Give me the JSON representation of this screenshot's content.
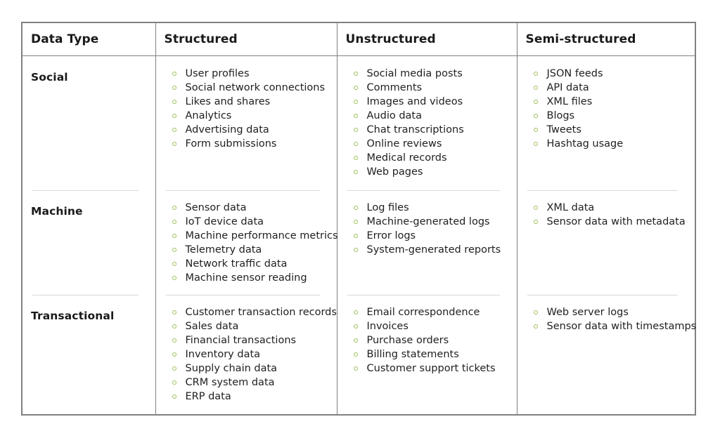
{
  "table": {
    "columns": [
      {
        "key": "data_type",
        "label": "Data Type"
      },
      {
        "key": "structured",
        "label": "Structured"
      },
      {
        "key": "unstructured",
        "label": "Unstructured"
      },
      {
        "key": "semi_structured",
        "label": "Semi-structured"
      }
    ],
    "bullet_color": "#9cbf5a",
    "border_color": "#808080",
    "separator_color": "#d9d9d9",
    "text_color": "#1f1f1f",
    "rows": [
      {
        "label": "Social",
        "structured": [
          "User profiles",
          "Social network connections",
          "Likes and shares",
          "Analytics",
          "Advertising data",
          "Form submissions"
        ],
        "unstructured": [
          "Social media posts",
          "Comments",
          "Images and videos",
          "Audio data",
          "Chat transcriptions",
          "Online reviews",
          "Medical records",
          "Web pages"
        ],
        "semi_structured": [
          "JSON feeds",
          "API data",
          "XML files",
          "Blogs",
          "Tweets",
          "Hashtag usage"
        ]
      },
      {
        "label": "Machine",
        "structured": [
          "Sensor data",
          "IoT device data",
          "Machine performance metrics",
          "Telemetry data",
          "Network traffic data",
          "Machine sensor reading"
        ],
        "unstructured": [
          "Log files",
          "Machine-generated logs",
          "Error logs",
          "System-generated reports"
        ],
        "semi_structured": [
          "XML data",
          "Sensor data with metadata"
        ]
      },
      {
        "label": "Transactional",
        "structured": [
          "Customer transaction records",
          "Sales data",
          "Financial transactions",
          "Inventory data",
          "Supply chain data",
          "CRM system data",
          "ERP data"
        ],
        "unstructured": [
          "Email correspondence",
          "Invoices",
          "Purchase orders",
          "Billing statements",
          "Customer support tickets"
        ],
        "semi_structured": [
          "Web server logs",
          "Sensor data with timestamps"
        ]
      }
    ]
  }
}
